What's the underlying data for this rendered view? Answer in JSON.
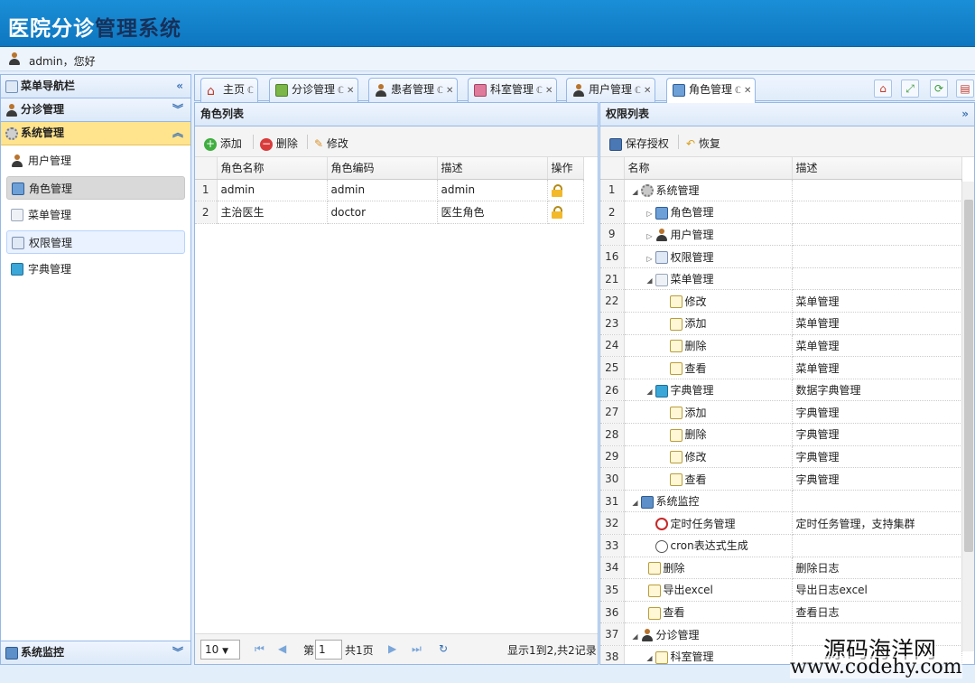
{
  "header": {
    "title_part1": "医院分诊",
    "title_part2": "管理系统"
  },
  "user": {
    "greeting": "admin，您好"
  },
  "sidebar": {
    "title": "菜单导航栏",
    "groups": [
      {
        "label": "分诊管理"
      },
      {
        "label": "系统管理"
      }
    ],
    "items": [
      {
        "label": "用户管理"
      },
      {
        "label": "角色管理"
      },
      {
        "label": "菜单管理"
      },
      {
        "label": "权限管理"
      },
      {
        "label": "字典管理"
      }
    ],
    "footer": "系统监控"
  },
  "tabs": [
    {
      "label": "主页"
    },
    {
      "label": "分诊管理"
    },
    {
      "label": "患者管理"
    },
    {
      "label": "科室管理"
    },
    {
      "label": "用户管理"
    },
    {
      "label": "角色管理"
    }
  ],
  "role_panel": {
    "title": "角色列表",
    "toolbar": {
      "add": "添加",
      "delete": "删除",
      "edit": "修改"
    },
    "columns": [
      "角色名称",
      "角色编码",
      "描述",
      "操作"
    ],
    "rows": [
      {
        "n": "1",
        "name": "admin",
        "code": "admin",
        "desc": "admin"
      },
      {
        "n": "2",
        "name": "主治医生",
        "code": "doctor",
        "desc": "医生角色"
      }
    ],
    "pager": {
      "size": "10",
      "page_label": "第",
      "page": "1",
      "total": "共1页",
      "info": "显示1到2,共2记录"
    }
  },
  "perm_panel": {
    "title": "权限列表",
    "toolbar": {
      "save": "保存授权",
      "restore": "恢复"
    },
    "columns": [
      "名称",
      "描述"
    ],
    "rows": [
      {
        "n": "1",
        "name": "系统管理",
        "desc": "",
        "indent": 0,
        "tri": "◢",
        "icon": "gear"
      },
      {
        "n": "2",
        "name": "角色管理",
        "desc": "",
        "indent": 1,
        "tri": "▷",
        "icon": "role"
      },
      {
        "n": "9",
        "name": "用户管理",
        "desc": "",
        "indent": 1,
        "tri": "▷",
        "icon": "person"
      },
      {
        "n": "16",
        "name": "权限管理",
        "desc": "",
        "indent": 1,
        "tri": "▷",
        "icon": "key"
      },
      {
        "n": "21",
        "name": "菜单管理",
        "desc": "",
        "indent": 1,
        "tri": "◢",
        "icon": "list"
      },
      {
        "n": "22",
        "name": "修改",
        "desc": "菜单管理",
        "indent": 2,
        "tri": "",
        "icon": "page"
      },
      {
        "n": "23",
        "name": "添加",
        "desc": "菜单管理",
        "indent": 2,
        "tri": "",
        "icon": "page"
      },
      {
        "n": "24",
        "name": "删除",
        "desc": "菜单管理",
        "indent": 2,
        "tri": "",
        "icon": "page"
      },
      {
        "n": "25",
        "name": "查看",
        "desc": "菜单管理",
        "indent": 2,
        "tri": "",
        "icon": "page"
      },
      {
        "n": "26",
        "name": "字典管理",
        "desc": "数据字典管理",
        "indent": 1,
        "tri": "◢",
        "icon": "dict"
      },
      {
        "n": "27",
        "name": "添加",
        "desc": "字典管理",
        "indent": 2,
        "tri": "",
        "icon": "page"
      },
      {
        "n": "28",
        "name": "删除",
        "desc": "字典管理",
        "indent": 2,
        "tri": "",
        "icon": "page"
      },
      {
        "n": "29",
        "name": "修改",
        "desc": "字典管理",
        "indent": 2,
        "tri": "",
        "icon": "page"
      },
      {
        "n": "30",
        "name": "查看",
        "desc": "字典管理",
        "indent": 2,
        "tri": "",
        "icon": "page"
      },
      {
        "n": "31",
        "name": "系统监控",
        "desc": "",
        "indent": 0,
        "tri": "◢",
        "icon": "monitor"
      },
      {
        "n": "32",
        "name": "定时任务管理",
        "desc": "定时任务管理，支持集群",
        "indent": 1,
        "tri": "",
        "icon": "clock"
      },
      {
        "n": "33",
        "name": "cron表达式生成",
        "desc": "",
        "indent": 1,
        "tri": "",
        "icon": "cron"
      },
      {
        "n": "34",
        "name": "删除",
        "desc": "删除日志",
        "indent": 0.5,
        "tri": "",
        "icon": "page"
      },
      {
        "n": "35",
        "name": "导出excel",
        "desc": "导出日志excel",
        "indent": 0.5,
        "tri": "",
        "icon": "page"
      },
      {
        "n": "36",
        "name": "查看",
        "desc": "查看日志",
        "indent": 0.5,
        "tri": "",
        "icon": "page"
      },
      {
        "n": "37",
        "name": "分诊管理",
        "desc": "",
        "indent": 0,
        "tri": "◢",
        "icon": "person"
      },
      {
        "n": "38",
        "name": "科室管理",
        "desc": "",
        "indent": 1,
        "tri": "◢",
        "icon": "page"
      }
    ]
  },
  "watermark": {
    "line1": "源码海洋网",
    "line2": "www.codehy.com"
  }
}
